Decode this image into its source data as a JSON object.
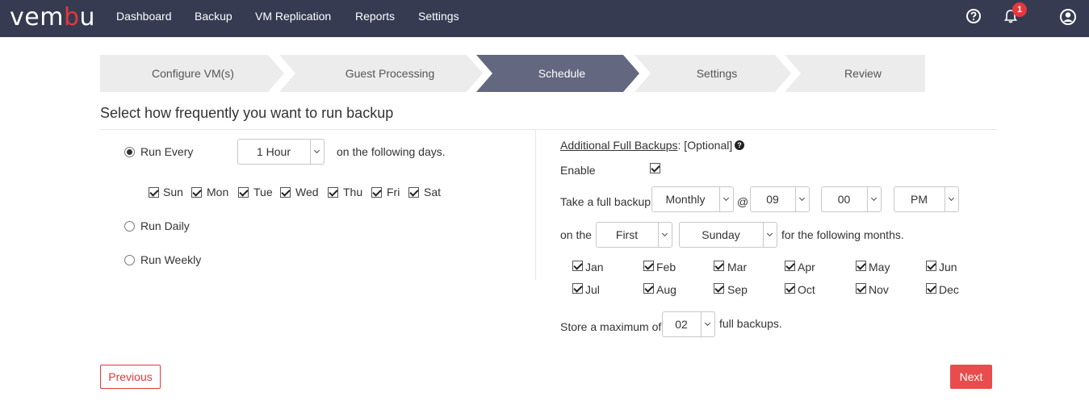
{
  "nav": {
    "logo_a": "vem",
    "logo_b": "b",
    "logo_c": "u",
    "items": [
      "Dashboard",
      "Backup",
      "VM Replication",
      "Reports",
      "Settings"
    ],
    "notification_count": "1"
  },
  "wizard": {
    "steps": [
      "Configure VM(s)",
      "Guest Processing",
      "Schedule",
      "Settings",
      "Review"
    ],
    "active": "Schedule"
  },
  "heading": "Select how frequently you want to run backup",
  "schedule": {
    "run_every_label": "Run Every",
    "interval": "1 Hour",
    "following_days": "on the following days.",
    "days": [
      "Sun",
      "Mon",
      "Tue",
      "Wed",
      "Thu",
      "Fri",
      "Sat"
    ],
    "run_daily_label": "Run Daily",
    "run_weekly_label": "Run Weekly",
    "selected": "Run Every"
  },
  "full_backup": {
    "title": "Additional Full Backups",
    "optional": ": [Optional]",
    "enable_label": "Enable",
    "take_label": "Take a full backup",
    "frequency": "Monthly",
    "at": "@",
    "hour": "09",
    "minute": "00",
    "ampm": "PM",
    "on_the": "on the",
    "week": "First",
    "weekday": "Sunday",
    "following_months": "for the following months.",
    "months": [
      "Jan",
      "Feb",
      "Mar",
      "Apr",
      "May",
      "Jun",
      "Jul",
      "Aug",
      "Sep",
      "Oct",
      "Nov",
      "Dec"
    ],
    "store_label": "Store a maximum of",
    "max_backups": "02",
    "full_backups": "full backups."
  },
  "buttons": {
    "previous": "Previous",
    "next": "Next"
  }
}
